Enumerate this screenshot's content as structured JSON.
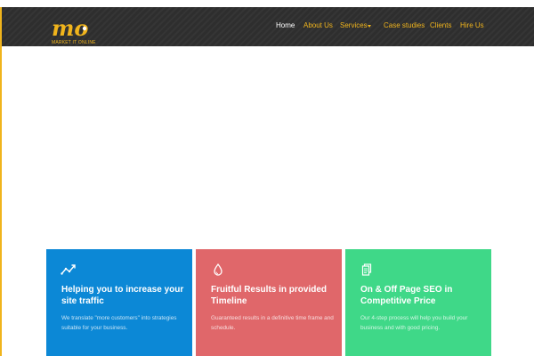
{
  "brand": {
    "logo_letters": "mo",
    "tagline": "MARKET IT ONLINE",
    "accent_color": "#f0b41c",
    "header_color": "#2e2e2e"
  },
  "nav": {
    "items": [
      {
        "label": "Home",
        "active": true
      },
      {
        "label": "About Us",
        "active": false
      },
      {
        "label": "Services",
        "active": false,
        "has_dropdown": true
      },
      {
        "label": "Case studies",
        "active": false
      },
      {
        "label": "Clients",
        "active": false
      },
      {
        "label": "Hire Us",
        "active": false
      }
    ]
  },
  "features": [
    {
      "icon": "trend-line-icon",
      "color": "#0c88d6",
      "title": "Helping you to increase your site traffic",
      "text": "We translate \"more customers\" into strategies suitable for your business."
    },
    {
      "icon": "water-drop-icon",
      "color": "#e0676a",
      "title": "Fruitful Results in provided Timeline",
      "text": "Guaranteed results in a definitive time frame and schedule."
    },
    {
      "icon": "document-copy-icon",
      "color": "#3fd888",
      "title": "On & Off Page SEO in Competitive Price",
      "text": "Our 4-step process will help you build your business and with good pricing."
    }
  ]
}
